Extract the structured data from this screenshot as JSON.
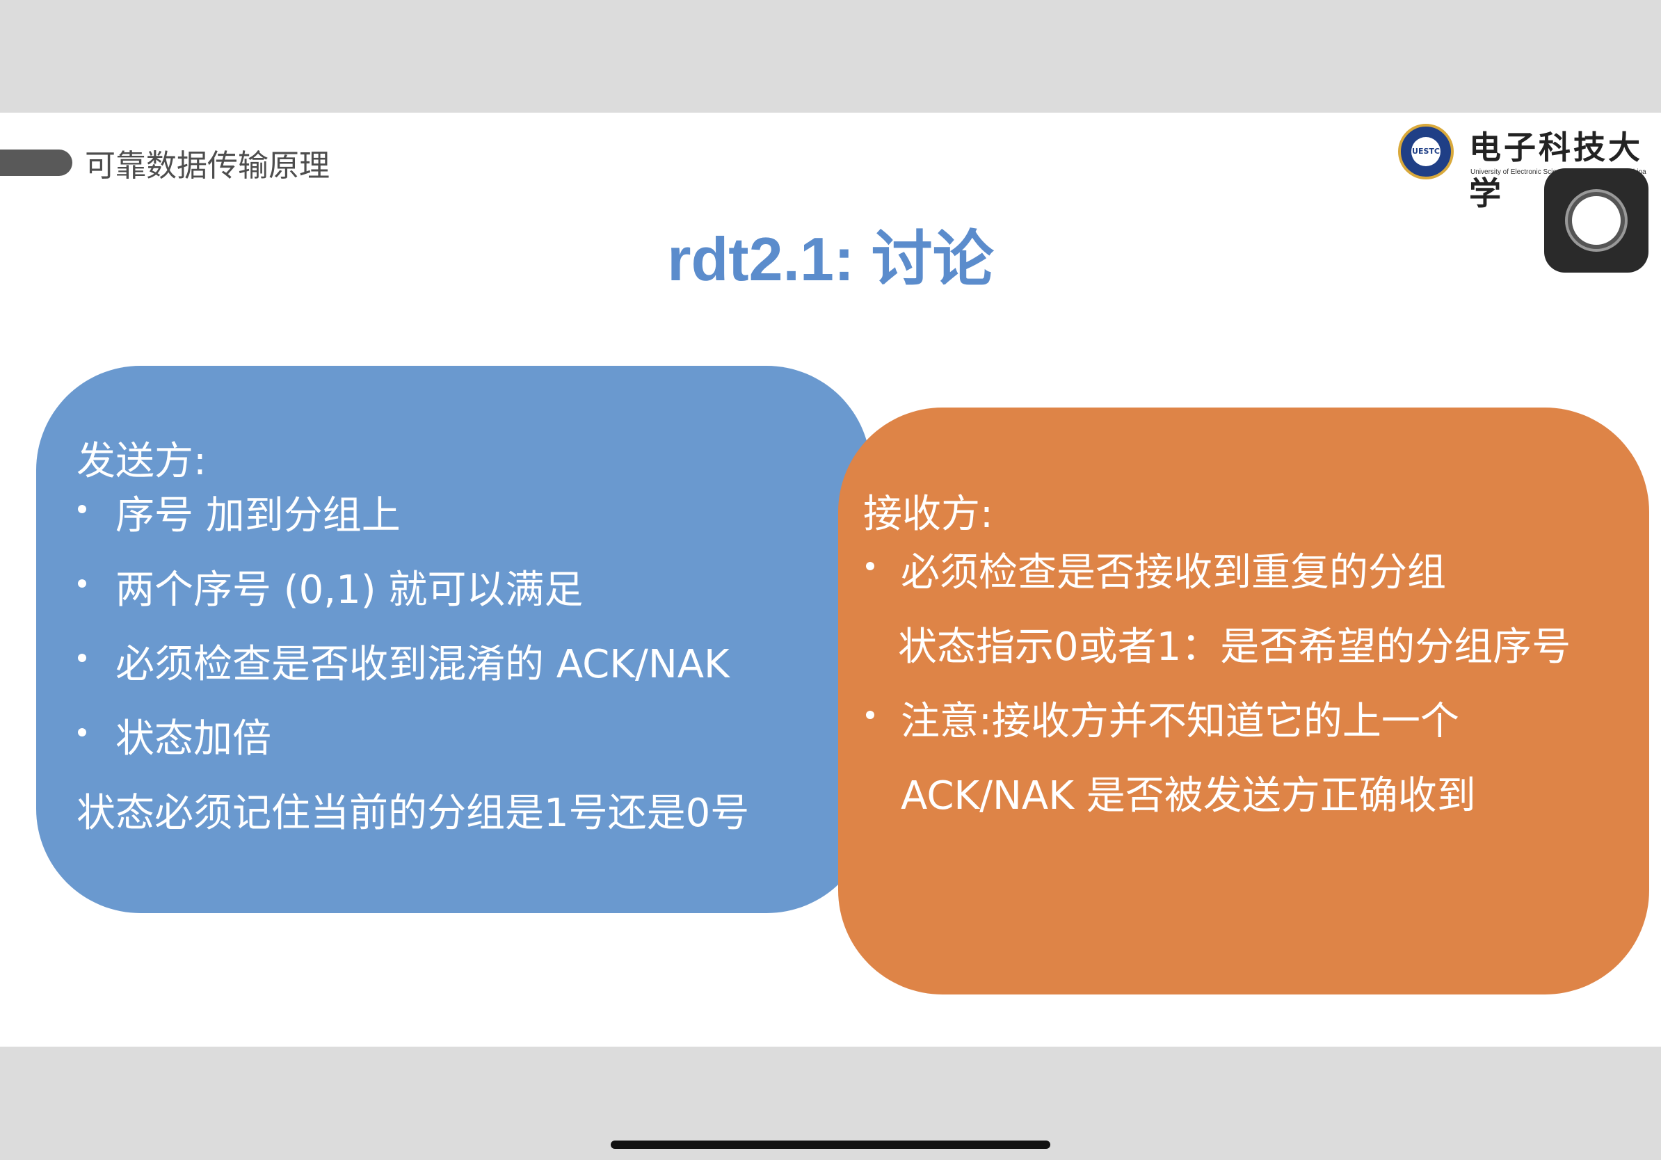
{
  "header": {
    "section_title": "可靠数据传输原理"
  },
  "logo": {
    "seal_text": "UESTC",
    "name": "电子科技大学",
    "subtitle": "University of Electronic Science and Technology of China"
  },
  "slide": {
    "title": "rdt2.1: 讨论"
  },
  "sender": {
    "heading": "发送方:",
    "bullets": [
      "序号 加到分组上",
      "两个序号 (0,1) 就可以满足",
      "必须检查是否收到混淆的 ACK/NAK",
      "状态加倍"
    ],
    "note": "状态必须记住当前的分组是1号还是0号"
  },
  "receiver": {
    "heading": "接收方:",
    "bullet1": "必须检查是否接收到重复的分组",
    "bullet1_cont": "状态指示0或者1：是否希望的分组序号",
    "bullet2": "注意:接收方并不知道它的上一个",
    "bullet2_cont": "ACK/NAK 是否被发送方正确收到"
  },
  "colors": {
    "title": "#5b8ccc",
    "sender_box": "#6a99cf",
    "receiver_box": "#de8447"
  }
}
